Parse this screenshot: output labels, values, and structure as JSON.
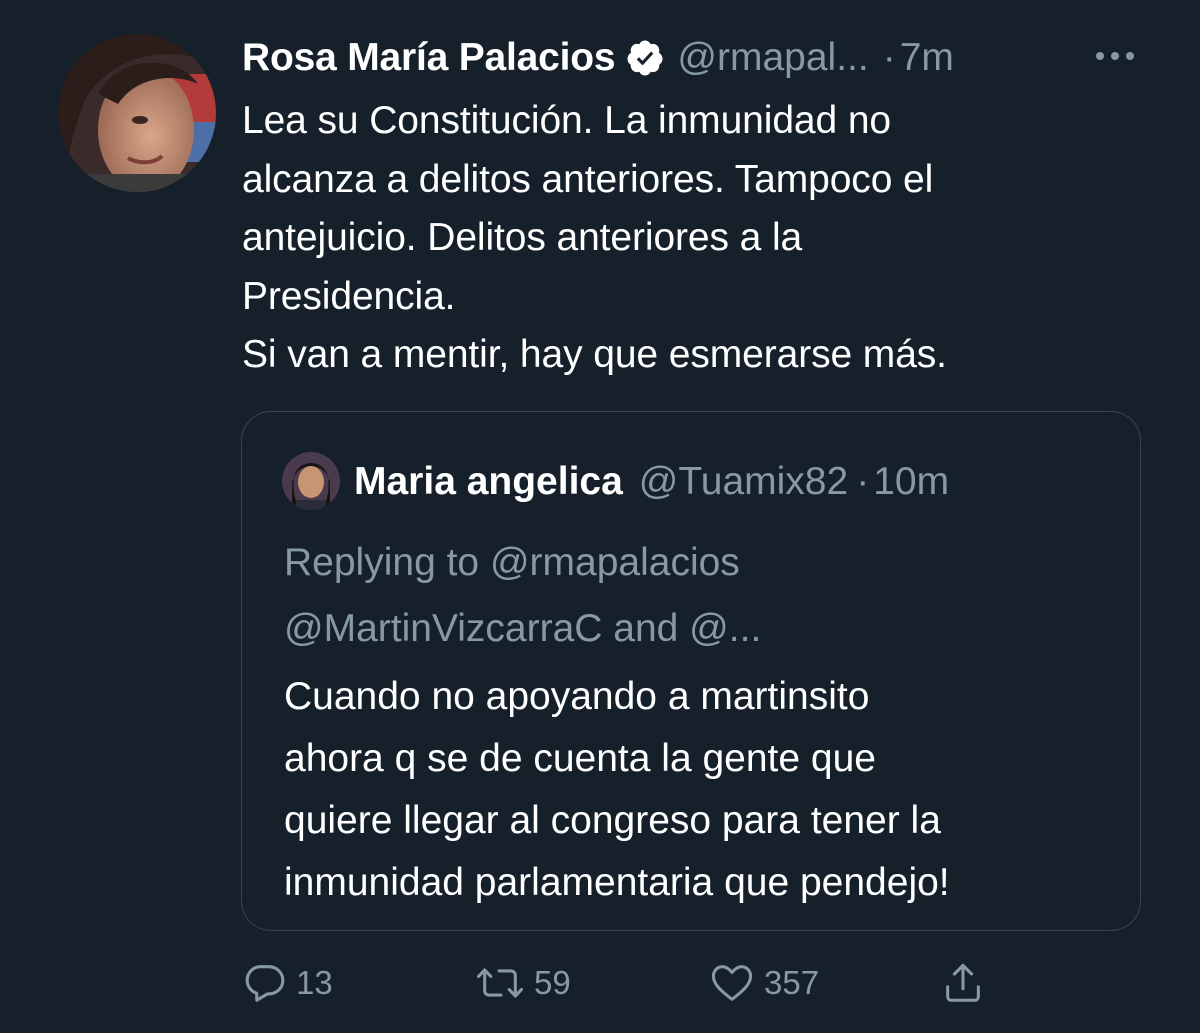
{
  "tweet": {
    "display_name": "Rosa María Palacios",
    "handle": "@rmapal...",
    "separator": "·",
    "time": "7m",
    "text_lines": [
      "Lea su Constitución. La inmunidad no",
      "alcanza a delitos anteriores. Tampoco el",
      "antejuicio. Delitos anteriores a la",
      "Presidencia.",
      "Si van a mentir, hay que esmerarse más."
    ],
    "icons": {
      "verified": "verified-badge-icon",
      "more": "more-options-icon",
      "avatar": "user-avatar"
    }
  },
  "quoted": {
    "display_name": "Maria angelica",
    "handle": "@Tuamix82",
    "separator": "·",
    "time": "10m",
    "reply_lines": [
      "Replying to @rmapalacios",
      "@MartinVizcarraC and @..."
    ],
    "text_lines": [
      "Cuando no apoyando a martinsito",
      "ahora q se de cuenta la gente que",
      "quiere llegar al congreso para tener la",
      "inmunidad parlamentaria que pendejo!"
    ]
  },
  "actions": {
    "reply_count": "13",
    "retweet_count": "59",
    "like_count": "357"
  },
  "colors": {
    "background": "#15202b",
    "primary_text": "#ffffff",
    "secondary_text": "#8899a6",
    "border": "#38444d"
  }
}
